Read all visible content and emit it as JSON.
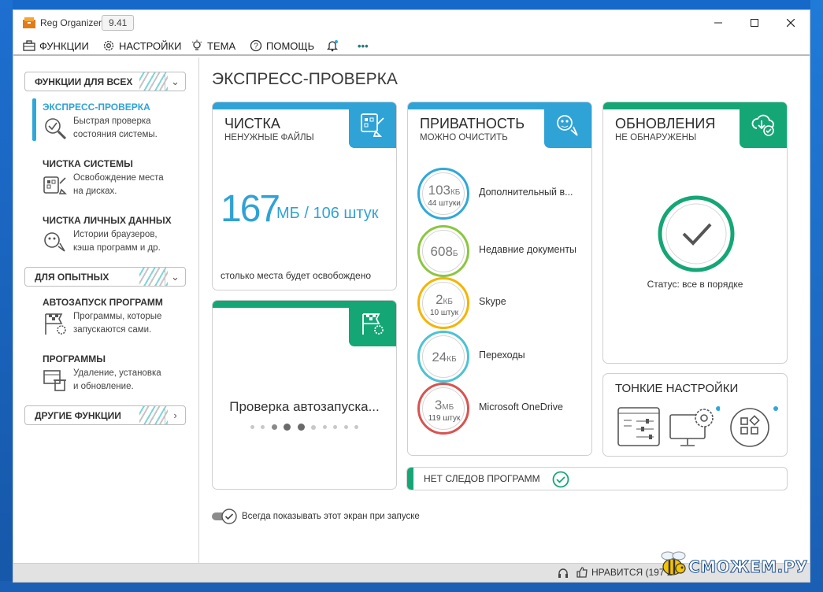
{
  "window": {
    "title": "Reg Organizer",
    "version": "9.41"
  },
  "menu": {
    "functions": "ФУНКЦИИ",
    "settings": "НАСТРОЙКИ",
    "theme": "ТЕМА",
    "help": "ПОМОЩЬ",
    "more": "•••"
  },
  "sidebar": {
    "section_all": "ФУНКЦИИ ДЛЯ ВСЕХ",
    "section_advanced": "ДЛЯ ОПЫТНЫХ",
    "section_other": "ДРУГИЕ ФУНКЦИИ",
    "items": [
      {
        "title": "ЭКСПРЕСС-ПРОВЕРКА",
        "desc1": "Быстрая проверка",
        "desc2": "состояния системы."
      },
      {
        "title": "ЧИСТКА СИСТЕМЫ",
        "desc1": "Освобождение места",
        "desc2": "на дисках."
      },
      {
        "title": "ЧИСТКА ЛИЧНЫХ ДАННЫХ",
        "desc1": "Истории браузеров,",
        "desc2": "кэша программ и др."
      },
      {
        "title": "АВТОЗАПУСК ПРОГРАММ",
        "desc1": "Программы, которые",
        "desc2": "запускаются сами."
      },
      {
        "title": "ПРОГРАММЫ",
        "desc1": "Удаление, установка",
        "desc2": "и обновление."
      }
    ]
  },
  "main": {
    "title": "ЭКСПРЕСС-ПРОВЕРКА",
    "cleaning": {
      "title": "ЧИСТКА",
      "subtitle": "НЕНУЖНЫЕ ФАЙЛЫ",
      "number": "167",
      "unit": "МБ / 106 штук",
      "footer": "столько места будет освобождено"
    },
    "privacy": {
      "title": "ПРИВАТНОСТЬ",
      "subtitle": "МОЖНО ОЧИСТИТЬ",
      "rows": [
        {
          "num": "103",
          "unit": "КБ",
          "count": "44 штуки",
          "label": "Дополнительный в...",
          "color": "#2fa8d9"
        },
        {
          "num": "608",
          "unit": "Б",
          "count": "",
          "label": "Недавние документы",
          "color": "#8cc63f"
        },
        {
          "num": "2",
          "unit": "КБ",
          "count": "10 штук",
          "label": "Skype",
          "color": "#f5b400"
        },
        {
          "num": "24",
          "unit": "КБ",
          "count": "",
          "label": "Переходы",
          "color": "#4cc3d4"
        },
        {
          "num": "3",
          "unit": "МБ",
          "count": "119 штук",
          "label": "Microsoft OneDrive",
          "color": "#d9534f"
        }
      ]
    },
    "updates": {
      "title": "ОБНОВЛЕНИЯ",
      "subtitle": "НЕ ОБНАРУЖЕНЫ",
      "status": "Статус: все в порядке"
    },
    "autorun": {
      "loading": "Проверка автозапуска..."
    },
    "tweaks": {
      "title": "ТОНКИЕ НАСТРОЙКИ"
    },
    "notrace": {
      "label": "НЕТ СЛЕДОВ ПРОГРАММ"
    },
    "show_on_start": "Всегда показывать этот экран при запуске"
  },
  "statusbar": {
    "like": "НРАВИТСЯ (197 2"
  },
  "watermark": "СМОЖЕМ.РУ",
  "colors": {
    "blue": "#2fa2d6",
    "green": "#15a676",
    "accent": "#2fa8d9"
  }
}
